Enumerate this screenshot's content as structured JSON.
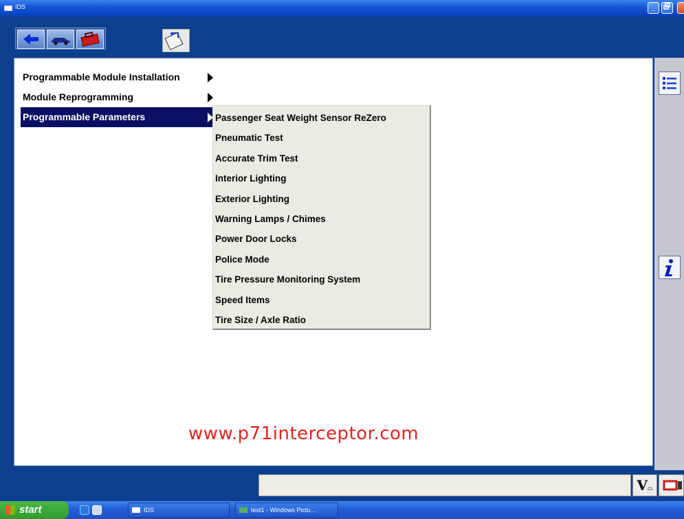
{
  "window": {
    "title": "IDS"
  },
  "menu": {
    "items": [
      {
        "label": "Programmable Module Installation"
      },
      {
        "label": "Module Reprogramming"
      },
      {
        "label": "Programmable Parameters"
      }
    ],
    "submenu": [
      {
        "label": "Passenger Seat Weight Sensor ReZero"
      },
      {
        "label": "Pneumatic Test"
      },
      {
        "label": "Accurate Trim Test"
      },
      {
        "label": "Interior Lighting"
      },
      {
        "label": "Exterior Lighting"
      },
      {
        "label": "Warning Lamps / Chimes"
      },
      {
        "label": "Power Door Locks"
      },
      {
        "label": "Police Mode"
      },
      {
        "label": "Tire Pressure Monitoring System"
      },
      {
        "label": "Speed Items"
      },
      {
        "label": "Tire Size / Axle Ratio"
      }
    ]
  },
  "watermark": "www.p71interceptor.com",
  "status": {
    "vbutton_label": "V"
  },
  "taskbar": {
    "start_label": "start",
    "tasks": [
      {
        "label": "IDS"
      },
      {
        "label": "test1 - Windows Pictu..."
      }
    ]
  },
  "colors": {
    "selected_bg": "#0a0f63",
    "watermark": "#e2251e",
    "app_bg": "#0e3f8e"
  }
}
